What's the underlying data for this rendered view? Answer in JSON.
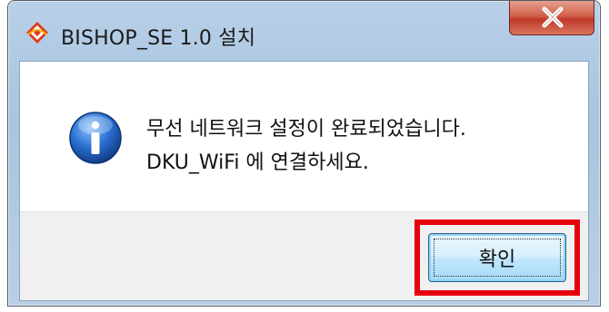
{
  "window": {
    "title": "BISHOP_SE 1.0 설치",
    "app_icon": "wifi-signal-icon",
    "close_icon": "close-icon"
  },
  "message": {
    "icon": "info-icon",
    "line1": "무선 네트워크 설정이 완료되었습니다.",
    "line2": "DKU_WiFi 에 연결하세요."
  },
  "buttons": {
    "ok_label": "확인"
  },
  "colors": {
    "highlight": "#e8000f",
    "close_button": "#c0392b",
    "info_blue": "#1f5fb8"
  }
}
